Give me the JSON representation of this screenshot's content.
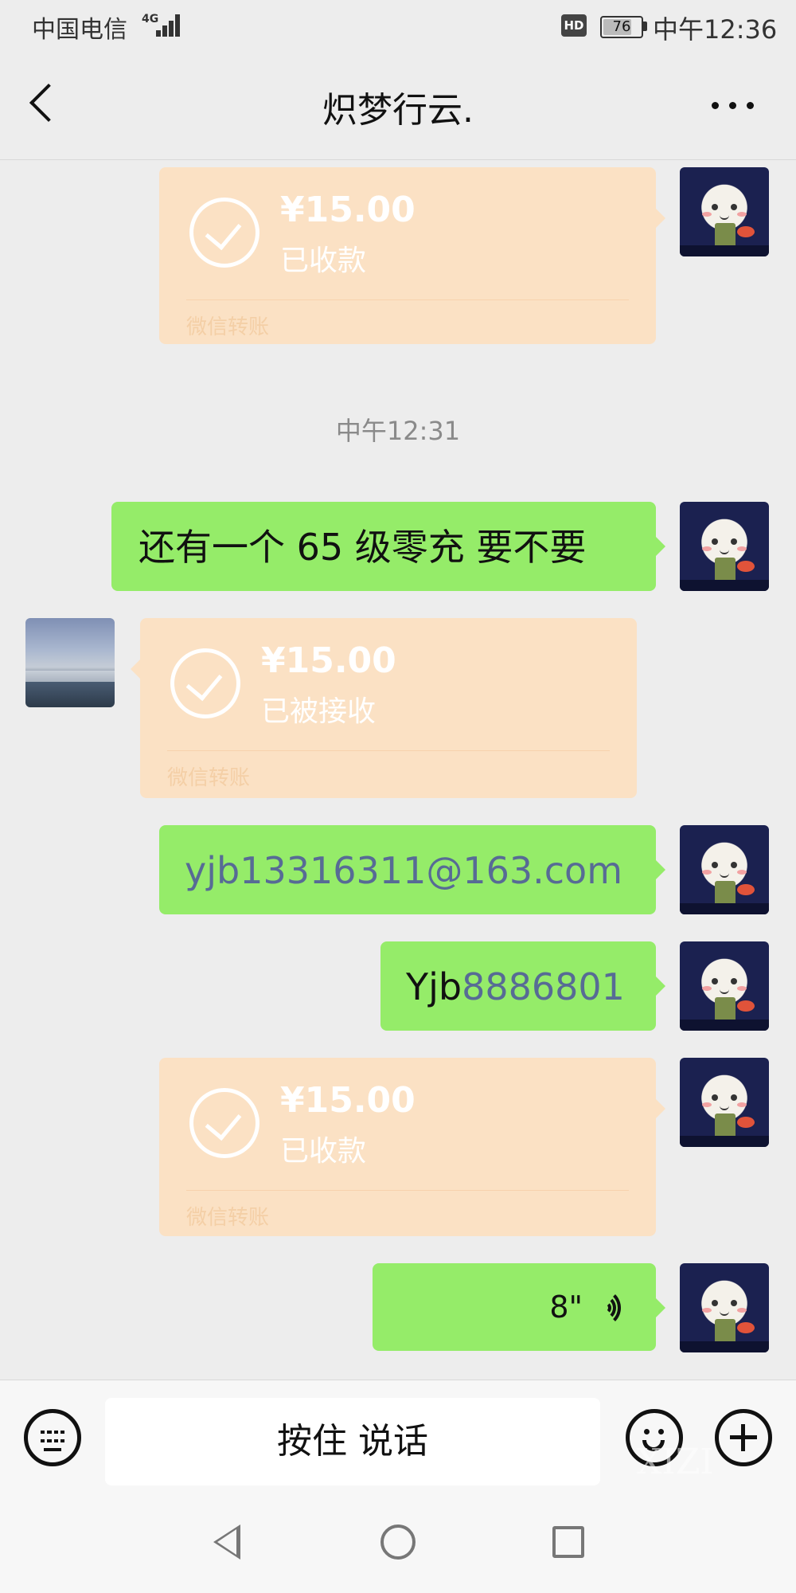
{
  "status_bar": {
    "carrier": "中国电信",
    "network": "4G",
    "hd": "HD",
    "battery": "76",
    "battery_level": 0.76,
    "time": "中午12:36"
  },
  "nav": {
    "title": "炽梦行云.",
    "back_icon": "back-chevron-icon",
    "more_icon": "more-dots-icon"
  },
  "messages": [
    {
      "type": "transfer",
      "sender": "me",
      "amount": "¥15.00",
      "status": "已收款",
      "label": "微信转账"
    },
    {
      "type": "time",
      "text": "中午12:31"
    },
    {
      "type": "text",
      "sender": "me",
      "text": "还有一个 65 级零充 要不要"
    },
    {
      "type": "transfer",
      "sender": "other",
      "amount": "¥15.00",
      "status": "已被接收",
      "label": "微信转账"
    },
    {
      "type": "text",
      "sender": "me",
      "text": "yjb13316311@163.com"
    },
    {
      "type": "text",
      "sender": "me",
      "text_prefix": "Yjb",
      "text_link": "8886801"
    },
    {
      "type": "transfer",
      "sender": "me",
      "amount": "¥15.00",
      "status": "已收款",
      "label": "微信转账"
    },
    {
      "type": "voice",
      "sender": "me",
      "duration": "8\""
    }
  ],
  "input_bar": {
    "hold_to_talk": "按住 说话",
    "keyboard_icon": "keyboard-icon",
    "emoji_icon": "emoji-icon",
    "plus_icon": "plus-icon"
  },
  "watermark": "XIZI",
  "colors": {
    "background": "#ededed",
    "text_bubble": "#95ec69",
    "transfer_bubble": "#fbe1c4",
    "link_text": "#576b95"
  }
}
